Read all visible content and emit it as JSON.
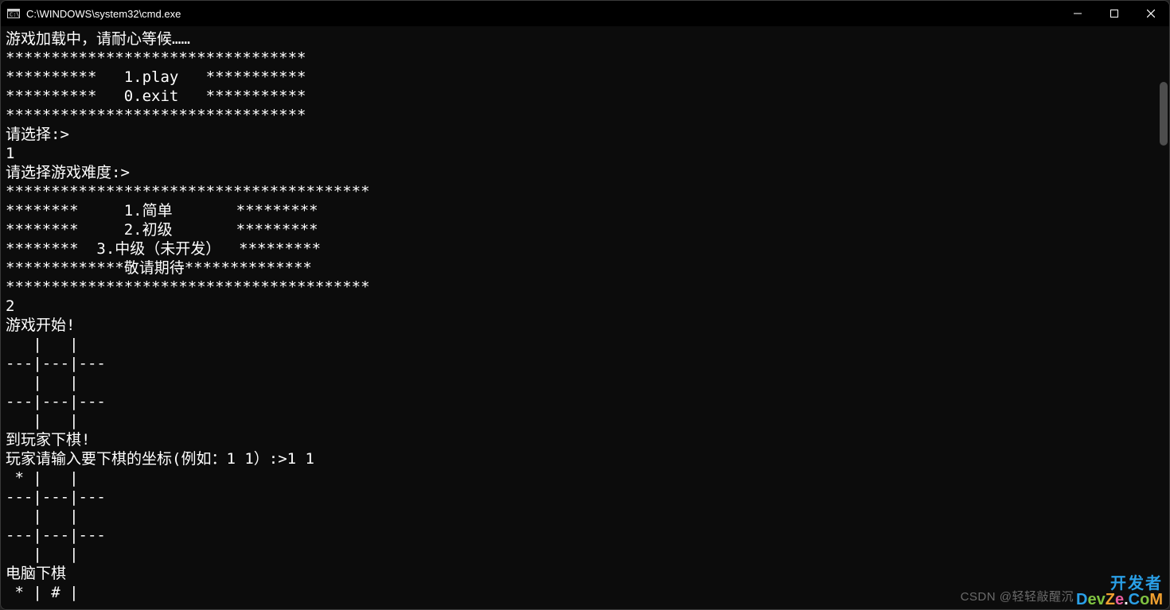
{
  "window": {
    "title": "C:\\WINDOWS\\system32\\cmd.exe"
  },
  "console": {
    "lines": [
      "游戏加载中，请耐心等候……",
      "*********************************",
      "**********   1.play   ***********",
      "**********   0.exit   ***********",
      "*********************************",
      "请选择:>",
      "1",
      "请选择游戏难度:>",
      "****************************************",
      "********     1.简单       *********",
      "********     2.初级       *********",
      "********  3.中级（未开发）  *********",
      "*************敬请期待**************",
      "****************************************",
      "2",
      "游戏开始!",
      "   |   |",
      "---|---|---",
      "   |   |",
      "---|---|---",
      "   |   |",
      "到玩家下棋!",
      "玩家请输入要下棋的坐标(例如：1 1）:>1 1",
      " * |   |",
      "---|---|---",
      "   |   |",
      "---|---|---",
      "   |   |",
      "电脑下棋",
      " * | # |"
    ]
  },
  "watermark": {
    "csdn": "CSDN @轻轻敲醒沉",
    "devze_line1": "开发者",
    "devze_line2": "DevZe.CoM"
  }
}
